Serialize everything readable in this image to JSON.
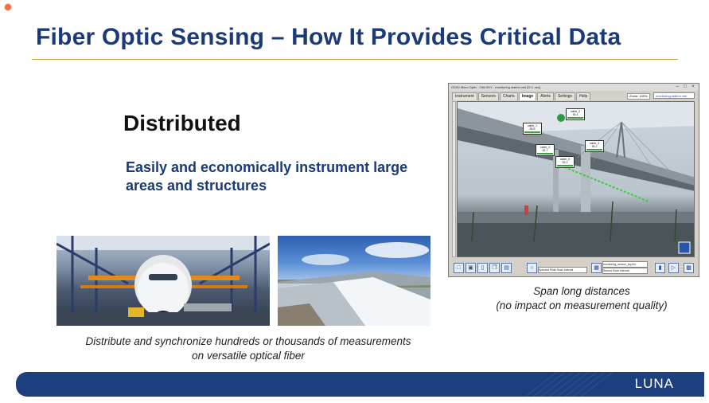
{
  "slide": {
    "title": "Fiber Optic Sensing – How It Provides Critical Data",
    "heading": "Distributed",
    "subtitle": "Easily and economically instrument large areas and structures",
    "caption_left": "Distribute and synchronize hundreds or thousands of measurements on versatile optical fiber",
    "caption_right_line1": "Span long distances",
    "caption_right_line2": "(no impact on measurement quality)",
    "logo": "LUNA",
    "colors": {
      "title": "#1b3a78",
      "rule": "#c9a64a",
      "footer": "#1d3f7d",
      "record": "#f26b4f"
    }
  },
  "app": {
    "title": "ODiSI Micro Optix - ONLSKY - monitoring station.xml [D:\\L.xsv]",
    "tabs": [
      "Instrument",
      "Sensors",
      "Charts",
      "Image",
      "Alerts",
      "Settings",
      "Help"
    ],
    "active_tab": "Image",
    "zoom": "Zoom: 100%",
    "profile": "monitoring-station.xml",
    "sensors": [
      {
        "name": "cable_1",
        "value": "55.8"
      },
      {
        "name": "cable_2",
        "value": "54.4"
      },
      {
        "name": "cable_4",
        "value": "52.7"
      },
      {
        "name": "cable_5",
        "value": "53.1"
      },
      {
        "name": "cable_3",
        "value": "55.2"
      }
    ],
    "bottom": {
      "field1": "Spectral Peak Scan Interval",
      "field2": "monitoring_sensor_log.bin",
      "field3": "Sensor Scan Interval"
    },
    "window_controls": [
      "–",
      "□",
      "×"
    ]
  }
}
